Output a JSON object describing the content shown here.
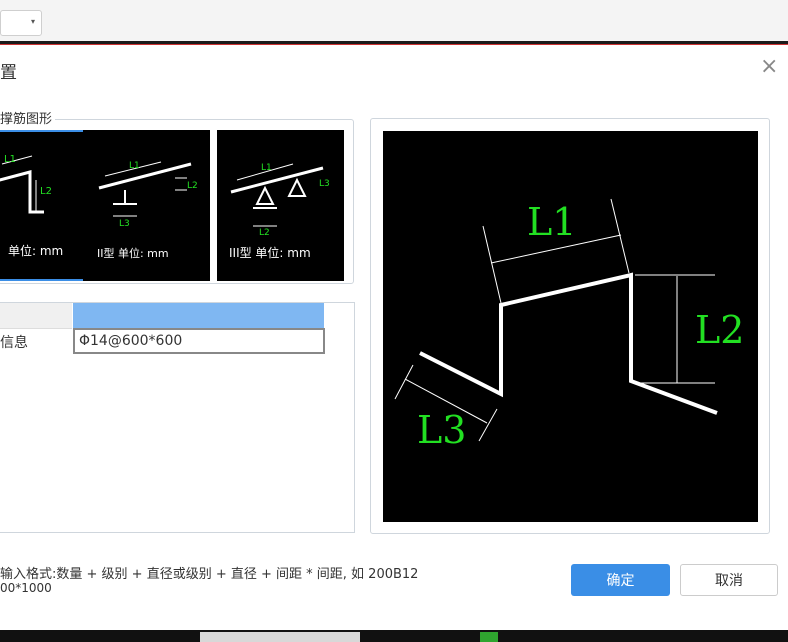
{
  "dialog": {
    "title": "置",
    "close_glyph": "×",
    "shapes_legend": "撑筋图形"
  },
  "shapes": [
    {
      "caption": "单位: mm",
      "selected": true
    },
    {
      "caption": "II型 单位: mm",
      "selected": false
    },
    {
      "caption": "III型 单位: mm",
      "selected": false
    }
  ],
  "thumb_labels": {
    "t1": [
      "L1",
      "L2"
    ],
    "t2": [
      "L1",
      "L2",
      "L3"
    ],
    "t3": [
      "L1",
      "L2",
      "L3"
    ]
  },
  "table": {
    "row_label": "信息",
    "row_value": "Φ14@600*600"
  },
  "preview_labels": {
    "l1": "L1",
    "l2": "L2",
    "l3": "L3"
  },
  "hint": {
    "line1": "输入格式:数量 + 级别 + 直径或级别 + 直径 + 间距 * 间距, 如 200B12",
    "line2": "00*1000"
  },
  "buttons": {
    "ok": "确定",
    "cancel": "取消"
  },
  "colors": {
    "accent": "#3a8ee6",
    "dimension_green": "#22e022",
    "header_blue": "#7fb7f2"
  }
}
